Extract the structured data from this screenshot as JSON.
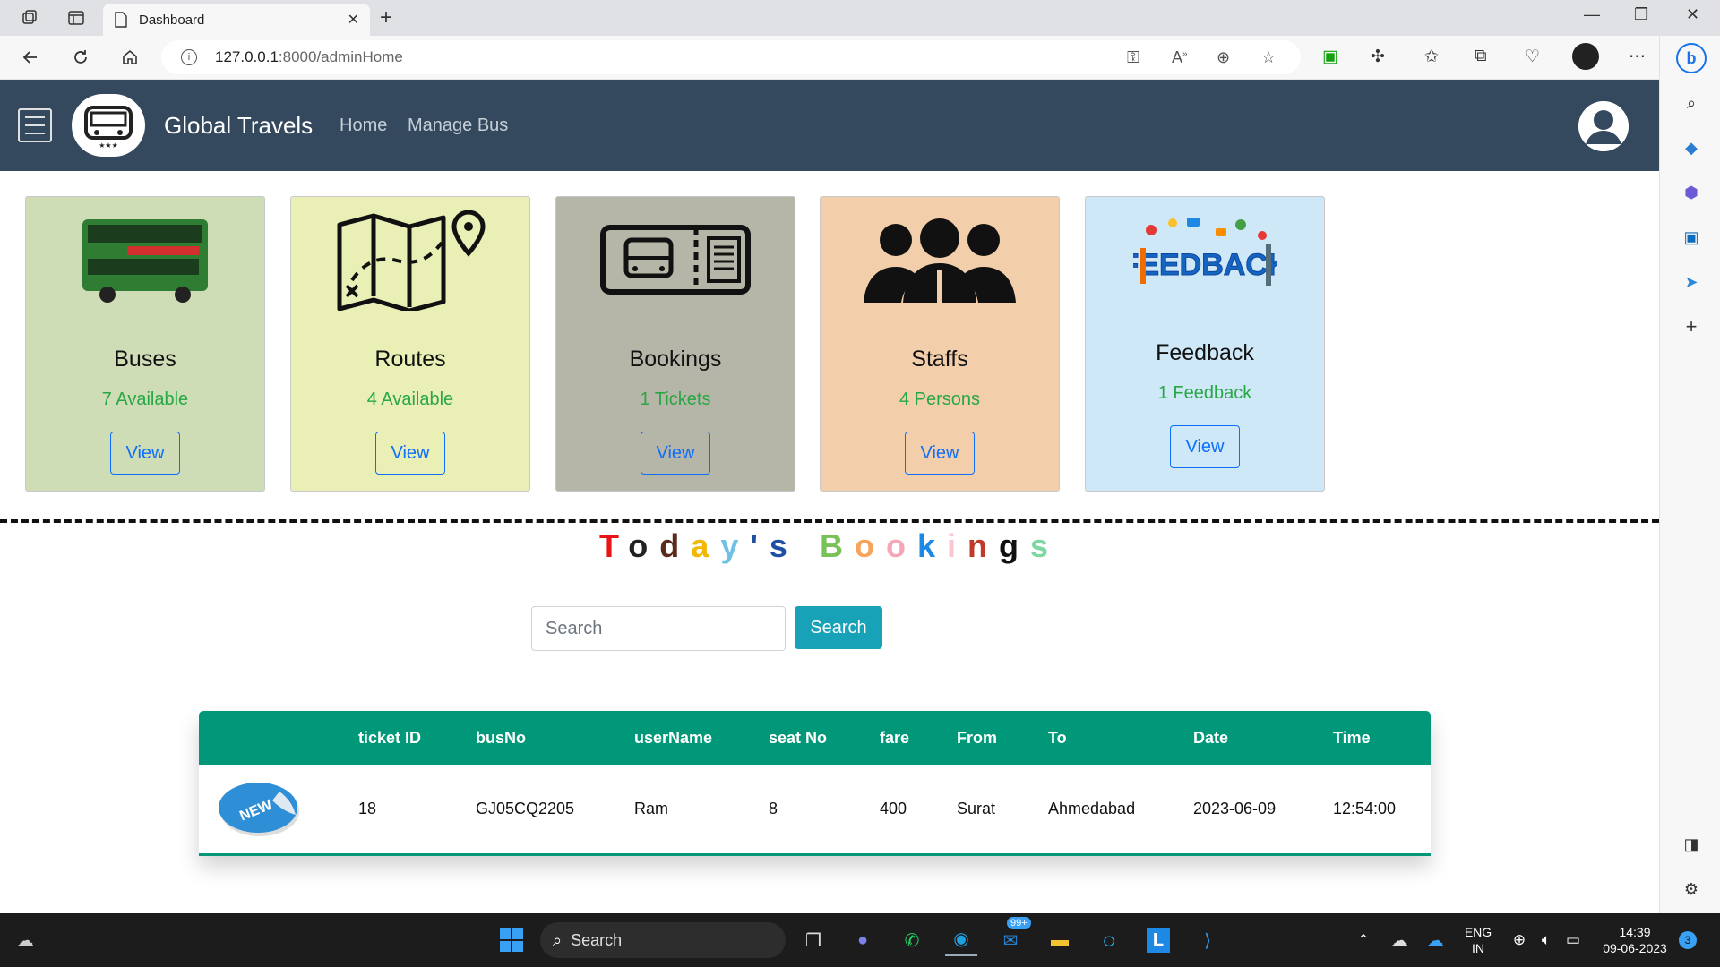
{
  "browser": {
    "tab_title": "Dashboard",
    "url_host": "127.0.0.1",
    "url_rest": ":8000/adminHome"
  },
  "navbar": {
    "brand": "Global Travels",
    "links": [
      "Home",
      "Manage Bus"
    ]
  },
  "cards": [
    {
      "title": "Buses",
      "subtitle": "7 Available",
      "button": "View",
      "bg": "#cfddb6",
      "icon": "double-decker-bus-image"
    },
    {
      "title": "Routes",
      "subtitle": "4 Available",
      "button": "View",
      "bg": "#eaefb5",
      "icon": "map-route-icon"
    },
    {
      "title": "Bookings",
      "subtitle": "1 Tickets",
      "button": "View",
      "bg": "#b5b5a8",
      "icon": "bus-ticket-icon"
    },
    {
      "title": "Staffs",
      "subtitle": "4 Persons",
      "button": "View",
      "bg": "#f2ceaa",
      "icon": "people-group-icon"
    },
    {
      "title": "Feedback",
      "subtitle": "1 Feedback",
      "button": "View",
      "bg": "#cfe8f7",
      "icon": "feedback-image"
    }
  ],
  "feedback_image_text": "FEEDBACK",
  "todays_bookings": {
    "letters": [
      {
        "ch": "T",
        "color": "#e81416"
      },
      {
        "ch": "o",
        "color": "#222222"
      },
      {
        "ch": "d",
        "color": "#5a2a1a"
      },
      {
        "ch": "a",
        "color": "#f2b800"
      },
      {
        "ch": "y",
        "color": "#6ec1e4"
      },
      {
        "ch": "'s",
        "color": "#1e4fa3"
      },
      {
        "ch": " ",
        "color": "#000000"
      },
      {
        "ch": "B",
        "color": "#79c257"
      },
      {
        "ch": "o",
        "color": "#f7a35c"
      },
      {
        "ch": "o",
        "color": "#f4a7b9"
      },
      {
        "ch": "k",
        "color": "#1e88e5"
      },
      {
        "ch": "i",
        "color": "#f9c6d0"
      },
      {
        "ch": "n",
        "color": "#c0392b"
      },
      {
        "ch": "g",
        "color": "#111111"
      },
      {
        "ch": "s",
        "color": "#7ed6a0"
      }
    ]
  },
  "search": {
    "placeholder": "Search",
    "button": "Search"
  },
  "table": {
    "headers": [
      "ticket ID",
      "busNo",
      "userName",
      "seat No",
      "fare",
      "From",
      "To",
      "Date",
      "Time"
    ],
    "rows": [
      {
        "badge": "NEW",
        "cells": [
          "18",
          "GJ05CQ2205",
          "Ram",
          "8",
          "400",
          "Surat",
          "Ahmedabad",
          "2023-06-09",
          "12:54:00"
        ]
      }
    ]
  },
  "taskbar": {
    "search": "Search",
    "mail_badge": "99+",
    "lang_top": "ENG",
    "lang_bottom": "IN",
    "time": "14:39",
    "date": "09-06-2023",
    "notifications": "3"
  }
}
